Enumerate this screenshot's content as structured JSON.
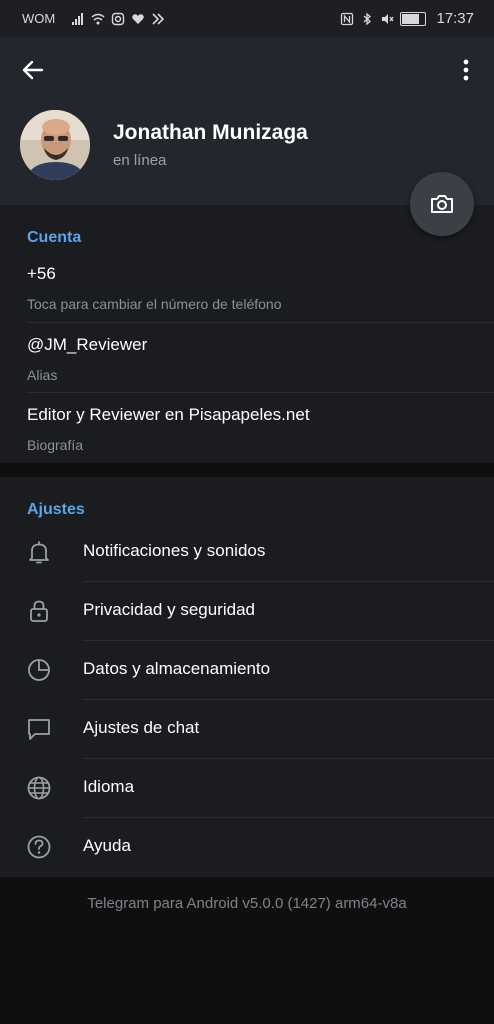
{
  "status_bar": {
    "carrier": "WOM",
    "time": "17:37",
    "icons": [
      "signal-icon",
      "wifi-icon",
      "instagram-icon",
      "heart-icon",
      "app-icon",
      "nfc-icon",
      "bluetooth-icon",
      "mute-icon",
      "battery-icon"
    ]
  },
  "profile": {
    "name": "Jonathan Munizaga",
    "status": "en línea"
  },
  "account": {
    "title": "Cuenta",
    "items": [
      {
        "value": "+56",
        "caption": "Toca para cambiar el número de teléfono"
      },
      {
        "value": "@JM_Reviewer",
        "caption": "Alias"
      },
      {
        "value": "Editor y Reviewer en Pisapapeles.net",
        "caption": "Biografía"
      }
    ]
  },
  "settings": {
    "title": "Ajustes",
    "items": [
      {
        "label": "Notificaciones y sonidos",
        "icon": "bell-icon"
      },
      {
        "label": "Privacidad y seguridad",
        "icon": "lock-icon"
      },
      {
        "label": "Datos y almacenamiento",
        "icon": "pie-chart-icon"
      },
      {
        "label": "Ajustes de chat",
        "icon": "chat-bubble-icon"
      },
      {
        "label": "Idioma",
        "icon": "globe-icon"
      },
      {
        "label": "Ayuda",
        "icon": "help-icon"
      }
    ]
  },
  "footer": {
    "version": "Telegram para Android v5.0.0 (1427) arm64-v8a"
  },
  "colors": {
    "accent": "#5aa4e8",
    "header_bg": "#23272d",
    "section_bg": "#1b1c1f",
    "page_bg": "#0f0f10"
  }
}
